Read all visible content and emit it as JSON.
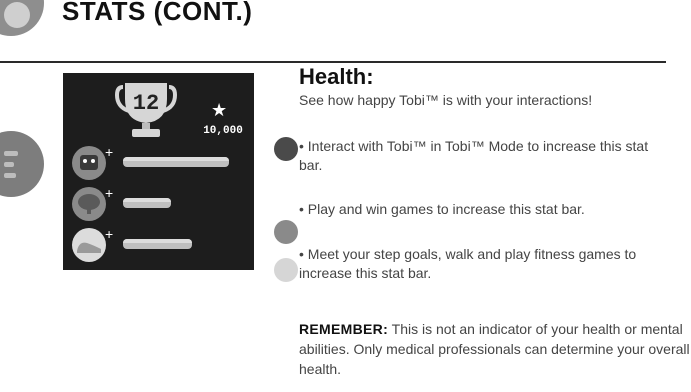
{
  "header": {
    "title": "STATS (CONT.)"
  },
  "device_screen": {
    "trophy_number": "12",
    "score_star": "★",
    "score_value": "10,000",
    "stat_bars": [
      {
        "stat": "interaction",
        "level": 0.86
      },
      {
        "stat": "games",
        "level": 0.39
      },
      {
        "stat": "fitness",
        "level": 0.56
      }
    ]
  },
  "section": {
    "title": "Health:",
    "subtitle": "See how happy Tobi™ is with your interactions!",
    "bullets": [
      {
        "icon": "tobi-face-icon",
        "text": "• Interact with Tobi™ in Tobi™ Mode to increase this stat bar."
      },
      {
        "icon": "brain-icon",
        "text": "• Play and win games to increase this stat bar."
      },
      {
        "icon": "sneaker-icon",
        "text": "• Meet your step goals, walk and play fitness games to increase this stat bar."
      }
    ],
    "remember_label": "REMEMBER:",
    "remember_text": " This is not an indicator of your health or mental abilities. Only medical professionals can determine your overall health."
  }
}
